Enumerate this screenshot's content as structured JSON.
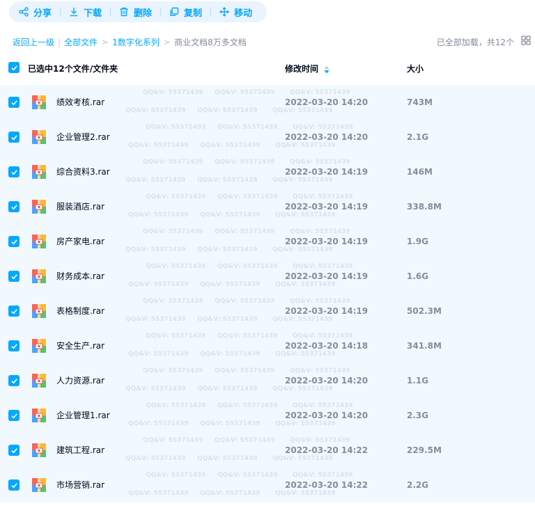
{
  "toolbar": {
    "share": "分享",
    "download": "下载",
    "delete": "删除",
    "copy": "复制",
    "move": "移动"
  },
  "breadcrumb": {
    "back": "返回上一级",
    "all_files": "全部文件",
    "level1": "1数字化系列",
    "current": "商业文档8万多文档"
  },
  "status": "已全部加载，共12个",
  "header": {
    "selected": "已选中12个文件/文件夹",
    "modified": "修改时间",
    "size": "大小"
  },
  "watermark": "QQ&V: 55371439",
  "colors": {
    "accent": "#06a7ff",
    "list_bg": "#f1f9ff",
    "toolbar_bg": "#eaf4fe"
  },
  "files": [
    {
      "name": "绩效考核.rar",
      "modified": "2022-03-20 14:20",
      "size": "743M",
      "checked": true
    },
    {
      "name": "企业管理2.rar",
      "modified": "2022-03-20 14:20",
      "size": "2.1G",
      "checked": true
    },
    {
      "name": "综合资料3.rar",
      "modified": "2022-03-20 14:19",
      "size": "146M",
      "checked": true
    },
    {
      "name": "服装酒店.rar",
      "modified": "2022-03-20 14:19",
      "size": "338.8M",
      "checked": true
    },
    {
      "name": "房产家电.rar",
      "modified": "2022-03-20 14:19",
      "size": "1.9G",
      "checked": true
    },
    {
      "name": "财务成本.rar",
      "modified": "2022-03-20 14:19",
      "size": "1.6G",
      "checked": true
    },
    {
      "name": "表格制度.rar",
      "modified": "2022-03-20 14:19",
      "size": "502.3M",
      "checked": true
    },
    {
      "name": "安全生产.rar",
      "modified": "2022-03-20 14:18",
      "size": "341.8M",
      "checked": true
    },
    {
      "name": "人力资源.rar",
      "modified": "2022-03-20 14:20",
      "size": "1.1G",
      "checked": true
    },
    {
      "name": "企业管理1.rar",
      "modified": "2022-03-20 14:20",
      "size": "2.3G",
      "checked": true
    },
    {
      "name": "建筑工程.rar",
      "modified": "2022-03-20 14:22",
      "size": "229.5M",
      "checked": true
    },
    {
      "name": "市场营销.rar",
      "modified": "2022-03-20 14:22",
      "size": "2.2G",
      "checked": true
    }
  ]
}
